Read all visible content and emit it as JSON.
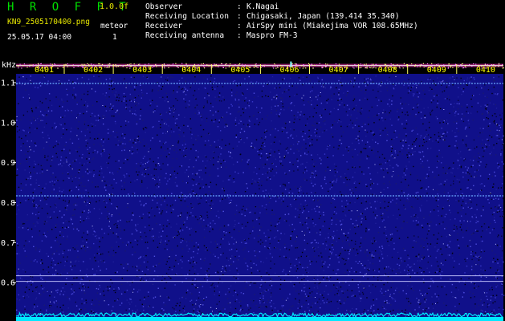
{
  "header": {
    "title": "H R O F F T",
    "version": "1.0.0f",
    "filename": "KN9_2505170400.png",
    "count_label": "meteor",
    "datetime": "25.05.17 04:00",
    "count_value": "1"
  },
  "metadata": [
    {
      "key": "Observer",
      "value": "K.Nagai"
    },
    {
      "key": "Receiving Location",
      "value": "Chigasaki, Japan (139.414 35.340)"
    },
    {
      "key": "Receiver",
      "value": "AirSpy mini (Miakejima VOR 108.65MHz)"
    },
    {
      "key": "Receiving antenna",
      "value": "Maspro FM-3"
    }
  ],
  "colors": {
    "background": "#000000",
    "noise_base": "#10108a",
    "time_tick_label": "#ffff00",
    "freq_label": "#ffffff",
    "carrier_line": "#ff60ff",
    "power_trace": "#00e8ff"
  },
  "chart_data": {
    "type": "heatmap",
    "title": "",
    "xlabel": "",
    "ylabel": "kHz",
    "x_ticks": [
      "0401",
      "0402",
      "0403",
      "0404",
      "0405",
      "0406",
      "0407",
      "0408",
      "0409",
      "0410"
    ],
    "y_ticks": [
      1.1,
      1.0,
      0.9,
      0.8,
      0.7,
      0.6
    ],
    "y_range": [
      0.585,
      1.155
    ],
    "x_range_minutes": [
      0,
      10
    ],
    "features": [
      {
        "kind": "strong-carrier",
        "freq_khz": 1.143
      },
      {
        "kind": "faint-line",
        "freq_khz": 1.098
      },
      {
        "kind": "faint-line",
        "freq_khz": 0.817
      },
      {
        "kind": "reference-line",
        "freq_khz": 0.617
      },
      {
        "kind": "reference-line",
        "freq_khz": 0.603
      }
    ],
    "meteor_events": [
      {
        "time": "04:05.9",
        "freq_khz": 1.143
      }
    ]
  }
}
